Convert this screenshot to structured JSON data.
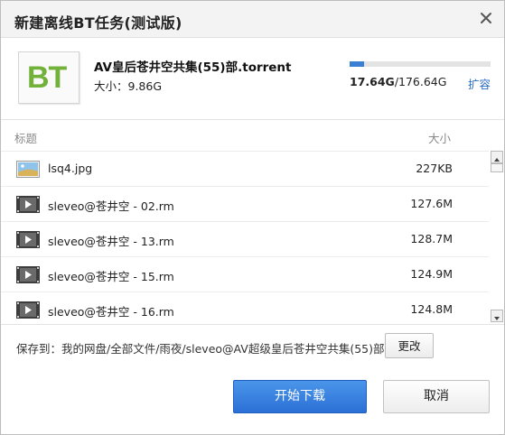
{
  "dialog": {
    "title": "新建离线BT任务(测试版)"
  },
  "torrent": {
    "icon_text": "BT",
    "name": "AV皇后苍井空共集(55)部.torrent",
    "size_text": "大小：9.86G"
  },
  "storage": {
    "used": "17.64G",
    "total": "/176.64G",
    "used_fraction": 0.1,
    "expand_label": "扩容",
    "fill_color": "#3b7fd4"
  },
  "file_list": {
    "col_title": "标题",
    "col_size": "大小",
    "rows": [
      {
        "icon": "image-file-icon",
        "name": "lsq4.jpg",
        "size": "227KB"
      },
      {
        "icon": "video-file-icon",
        "name": "sleveo@苍井空 - 02.rm",
        "size": "127.6M"
      },
      {
        "icon": "video-file-icon",
        "name": "sleveo@苍井空 - 13.rm",
        "size": "128.7M"
      },
      {
        "icon": "video-file-icon",
        "name": "sleveo@苍井空 - 15.rm",
        "size": "124.9M"
      },
      {
        "icon": "video-file-icon",
        "name": "sleveo@苍井空 - 16.rm",
        "size": "124.8M"
      }
    ]
  },
  "save": {
    "label": "保存到：我的网盘/全部文件/雨夜/sleveo@AV超级皇后苍井空共集(55)部",
    "change_label": "更改"
  },
  "actions": {
    "start_label": "开始下载",
    "cancel_label": "取消",
    "accent": "#2b70d6"
  }
}
